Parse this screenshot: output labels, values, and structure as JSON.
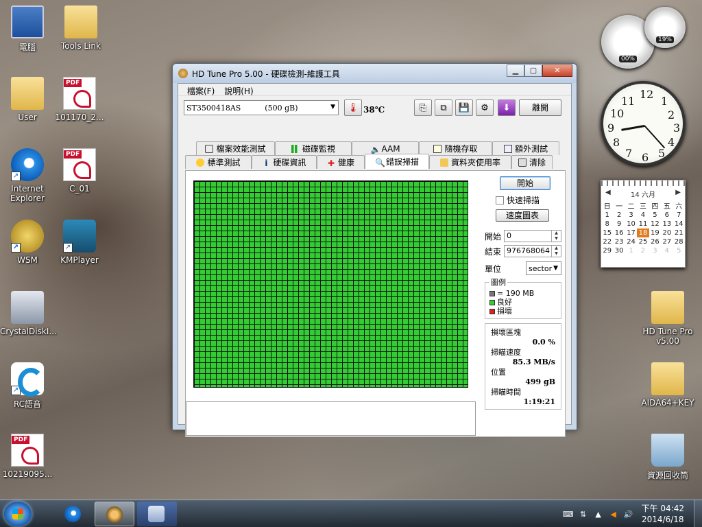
{
  "desktop": {
    "icons": [
      {
        "label": "電腦",
        "icon": "computer-icon"
      },
      {
        "label": "Tools Link",
        "icon": "folder-icon"
      },
      {
        "label": "User",
        "icon": "user-folder-icon"
      },
      {
        "label": "101170_2...",
        "icon": "pdf-icon"
      },
      {
        "label": "Internet Explorer",
        "icon": "internet-explorer-icon"
      },
      {
        "label": "C_01",
        "icon": "pdf-icon"
      },
      {
        "label": "WSM",
        "icon": "wsm-icon"
      },
      {
        "label": "KMPlayer",
        "icon": "kmplayer-icon"
      },
      {
        "label": "CrystalDiskI...",
        "icon": "crystaldiskinfo-icon"
      },
      {
        "label": "RC語音",
        "icon": "rc-voice-icon"
      },
      {
        "label": "10219095...",
        "icon": "pdf-icon"
      },
      {
        "label": "HD Tune Pro v5.00",
        "icon": "folder-icon"
      },
      {
        "label": "AIDA64+KEY",
        "icon": "folder-icon"
      },
      {
        "label": "資源回收筒",
        "icon": "recycle-bin-icon"
      }
    ]
  },
  "gadgets": {
    "cpu_meter": {
      "cpu": "00%",
      "mem": "19%"
    },
    "calendar": {
      "header": "14 六月",
      "weekdays": [
        "日",
        "一",
        "二",
        "三",
        "四",
        "五",
        "六"
      ],
      "weeks": [
        [
          "1",
          "2",
          "3",
          "4",
          "5",
          "6",
          "7"
        ],
        [
          "8",
          "9",
          "10",
          "11",
          "12",
          "13",
          "14"
        ],
        [
          "15",
          "16",
          "17",
          "18",
          "19",
          "20",
          "21"
        ],
        [
          "22",
          "23",
          "24",
          "25",
          "26",
          "27",
          "28"
        ],
        [
          "29",
          "30",
          "1",
          "2",
          "3",
          "4",
          "5"
        ]
      ],
      "today": "18"
    }
  },
  "window": {
    "title": "HD Tune Pro  5.00 - 硬碟檢測-維護工具",
    "menu": [
      "檔案(F)",
      "說明(H)"
    ],
    "drive": "ST3500418AS          (500 gB)",
    "temperature": "38℃",
    "exit_label": "離開",
    "tabs_top": [
      "檔案效能測試",
      "磁碟監視",
      "AAM",
      "隨機存取",
      "額外測試"
    ],
    "tabs_bottom": [
      "標準測試",
      "硬碟資訊",
      "健康",
      "錯誤掃描",
      "資料夾使用率",
      "清除"
    ],
    "active_tab": "錯誤掃描",
    "scan": {
      "start_label": "開始",
      "quick_scan_label": "快速掃描",
      "quick_scan_checked": false,
      "speed_chart_label": "速度圖表",
      "start_pos_label": "開始",
      "start_pos_value": "0",
      "end_pos_label": "結束",
      "end_pos_value": "976768064",
      "unit_label": "單位",
      "unit_value": "sector",
      "legend_title": "圖例",
      "legend": [
        {
          "label": "= 190 MB",
          "color": "#777777"
        },
        {
          "label": "良好",
          "color": "#33cc33"
        },
        {
          "label": "損壞",
          "color": "#dd2222"
        }
      ],
      "damaged_label": "損壞區塊",
      "damaged_value": "0.0 %",
      "speed_label": "掃瞄速度",
      "speed_value": "85.3 MB/s",
      "position_label": "位置",
      "position_value": "499 gB",
      "time_label": "掃瞄時間",
      "time_value": "1:19:21"
    }
  },
  "taskbar": {
    "clock_time": "下午 04:42",
    "clock_date": "2014/6/18"
  }
}
